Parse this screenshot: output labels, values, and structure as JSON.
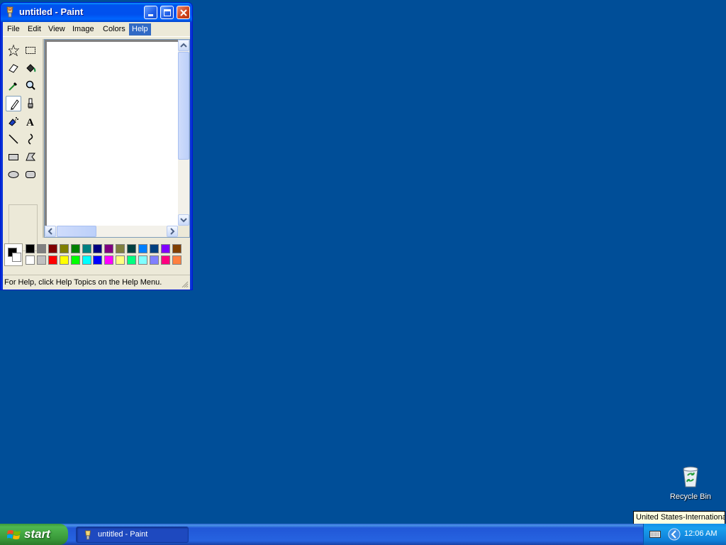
{
  "window": {
    "title": "untitled - Paint",
    "menu": [
      "File",
      "Edit",
      "View",
      "Image",
      "Colors",
      "Help"
    ],
    "active_menu": "Help",
    "status_text": "For Help, click Help Topics on the Help Menu.",
    "tools": [
      {
        "name": "free-form-select-icon"
      },
      {
        "name": "select-icon"
      },
      {
        "name": "eraser-icon"
      },
      {
        "name": "fill-with-color-icon"
      },
      {
        "name": "pick-color-icon"
      },
      {
        "name": "magnifier-icon"
      },
      {
        "name": "pencil-icon",
        "selected": true
      },
      {
        "name": "brush-icon"
      },
      {
        "name": "airbrush-icon"
      },
      {
        "name": "text-icon"
      },
      {
        "name": "line-icon"
      },
      {
        "name": "curve-icon"
      },
      {
        "name": "rectangle-icon"
      },
      {
        "name": "polygon-icon"
      },
      {
        "name": "ellipse-icon"
      },
      {
        "name": "rounded-rectangle-icon"
      }
    ],
    "text_tool_glyph": "A",
    "foreground_color": "#000000",
    "background_color": "#ffffff",
    "palette": [
      "#000000",
      "#808080",
      "#800000",
      "#808000",
      "#008000",
      "#008080",
      "#000080",
      "#800080",
      "#808040",
      "#004040",
      "#0080ff",
      "#004080",
      "#8000ff",
      "#804000",
      "#ffffff",
      "#c0c0c0",
      "#ff0000",
      "#ffff00",
      "#00ff00",
      "#00ffff",
      "#0000ff",
      "#ff00ff",
      "#ffff80",
      "#00ff80",
      "#80ffff",
      "#8080ff",
      "#ff0080",
      "#ff8040"
    ]
  },
  "desktop": {
    "background_color": "#004e98",
    "icons": [
      {
        "label": "Recycle Bin",
        "icon": "recycle-bin-icon"
      }
    ],
    "tooltip": "United States-International"
  },
  "taskbar": {
    "start_label": "start",
    "tasks": [
      {
        "label": "untitled - Paint",
        "icon": "paint-icon"
      }
    ],
    "clock": "12:06 AM",
    "tray_icons": [
      "keyboard-icon",
      "tray-expand-icon"
    ]
  }
}
